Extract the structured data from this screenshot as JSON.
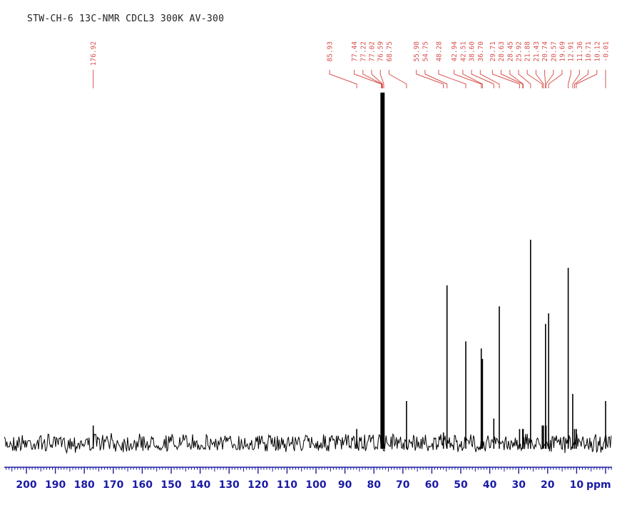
{
  "chart_data": {
    "type": "line",
    "title": "STW-CH-6 13C-NMR CDCL3 300K AV-300",
    "xlabel": "ppm",
    "ylabel": "",
    "x_reversed": true,
    "xlim": [
      -2,
      207
    ],
    "ylim": [
      -0.05,
      1.0
    ],
    "grid": false,
    "legend": "none",
    "x_ticks": [
      200,
      190,
      180,
      170,
      160,
      150,
      140,
      130,
      120,
      110,
      100,
      90,
      80,
      70,
      60,
      50,
      40,
      30,
      20,
      10
    ],
    "x_tick_labels": [
      "200",
      "190",
      "180",
      "170",
      "160",
      "150",
      "140",
      "130",
      "120",
      "110",
      "100",
      "90",
      "80",
      "70",
      "60",
      "50",
      "40",
      "30",
      "20",
      "10"
    ],
    "peak_labels": [
      "176.92",
      "85.93",
      "77.44",
      "77.22",
      "77.02",
      "76.59",
      "68.75",
      "55.98",
      "54.75",
      "48.28",
      "42.94",
      "42.51",
      "38.60",
      "36.70",
      "29.71",
      "28.63",
      "28.45",
      "25.92",
      "21.88",
      "21.43",
      "20.74",
      "20.57",
      "19.69",
      "12.91",
      "11.36",
      "10.71",
      "10.12",
      "-0.01"
    ],
    "peaks": [
      {
        "ppm": 176.92,
        "intensity": 0.05
      },
      {
        "ppm": 85.93,
        "intensity": 0.04
      },
      {
        "ppm": 77.44,
        "intensity": 1.0
      },
      {
        "ppm": 77.02,
        "intensity": 1.0
      },
      {
        "ppm": 76.59,
        "intensity": 1.0
      },
      {
        "ppm": 68.75,
        "intensity": 0.12
      },
      {
        "ppm": 55.98,
        "intensity": 0.03
      },
      {
        "ppm": 54.75,
        "intensity": 0.45
      },
      {
        "ppm": 48.28,
        "intensity": 0.29
      },
      {
        "ppm": 42.94,
        "intensity": 0.27
      },
      {
        "ppm": 42.51,
        "intensity": 0.24
      },
      {
        "ppm": 38.6,
        "intensity": 0.07
      },
      {
        "ppm": 36.7,
        "intensity": 0.39
      },
      {
        "ppm": 29.71,
        "intensity": 0.04
      },
      {
        "ppm": 28.63,
        "intensity": 0.04
      },
      {
        "ppm": 28.45,
        "intensity": 0.04
      },
      {
        "ppm": 25.92,
        "intensity": 0.58
      },
      {
        "ppm": 21.88,
        "intensity": 0.05
      },
      {
        "ppm": 21.43,
        "intensity": 0.05
      },
      {
        "ppm": 20.74,
        "intensity": 0.34
      },
      {
        "ppm": 20.57,
        "intensity": 0.05
      },
      {
        "ppm": 19.69,
        "intensity": 0.37
      },
      {
        "ppm": 12.91,
        "intensity": 0.5
      },
      {
        "ppm": 11.36,
        "intensity": 0.14
      },
      {
        "ppm": 10.71,
        "intensity": 0.04
      },
      {
        "ppm": 10.12,
        "intensity": 0.04
      },
      {
        "ppm": -0.01,
        "intensity": 0.12
      }
    ],
    "colors": {
      "spectrum": "#000000",
      "peak_labels": "#d9534f",
      "axis": "#1a1aa6",
      "title": "#222222"
    }
  }
}
